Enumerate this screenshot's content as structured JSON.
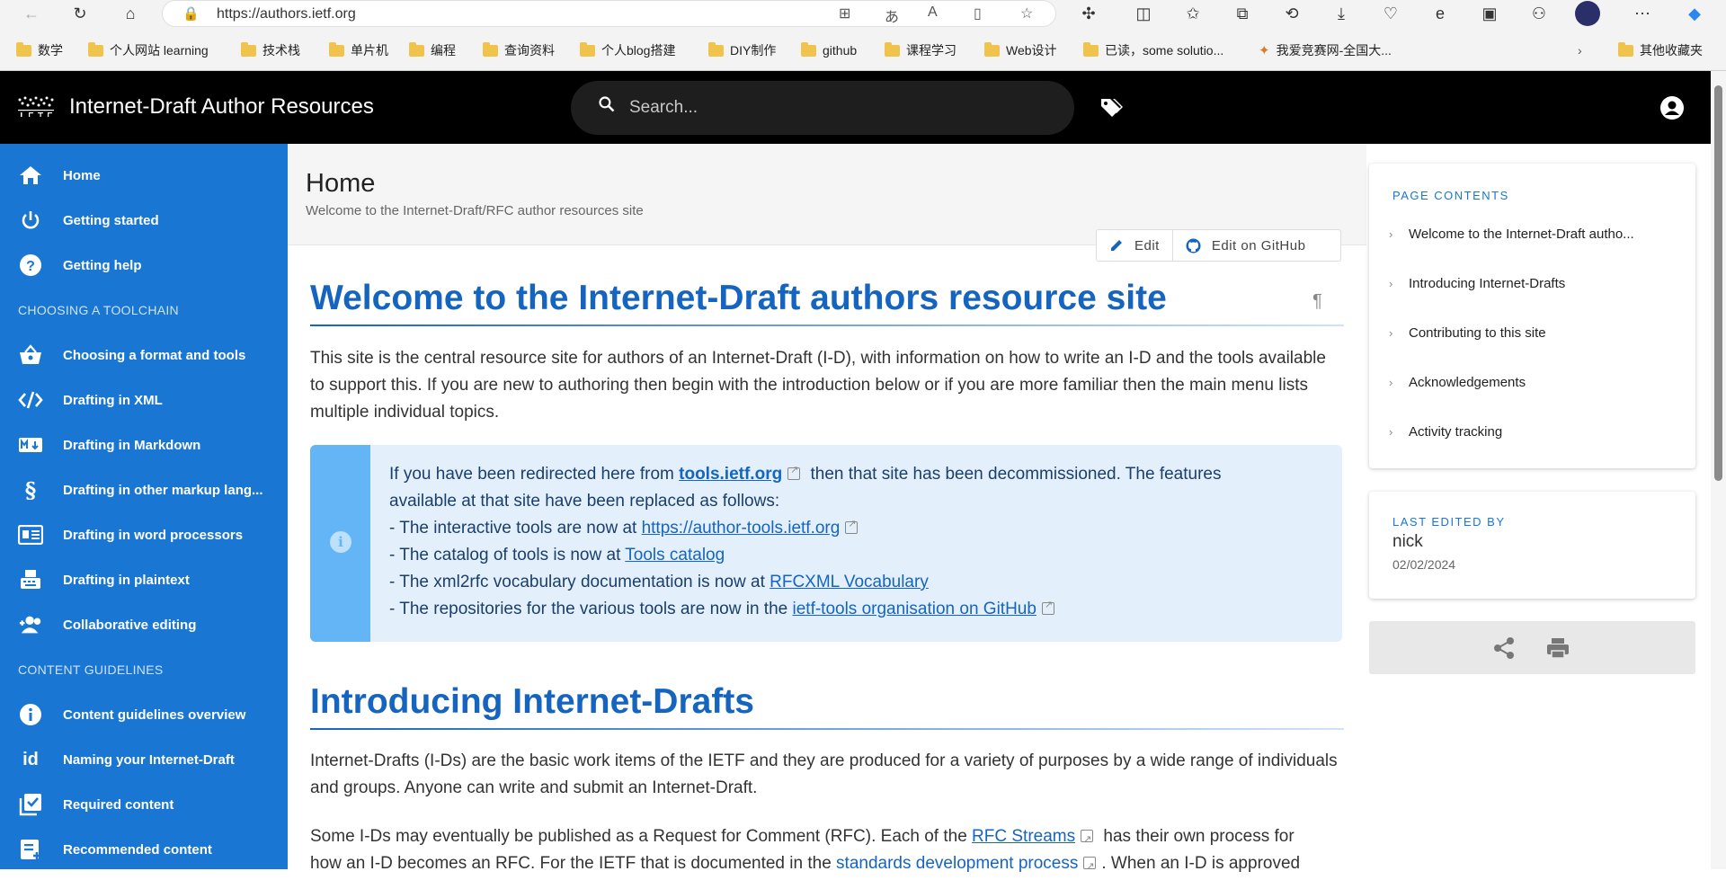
{
  "browser": {
    "url": "https://authors.ietf.org",
    "bookmarks": [
      "数学",
      "个人网站 learning",
      "技术栈",
      "单片机",
      "编程",
      "查询资料",
      "个人blog搭建",
      "DIY制作",
      "github",
      "课程学习",
      "Web设计",
      "已读，some solutio...",
      "我爱竞赛网-全国大...",
      "其他收藏夹"
    ]
  },
  "header": {
    "title": "Internet-Draft Author Resources",
    "logo_text": "I E T F",
    "search_placeholder": "Search..."
  },
  "sidebar": {
    "items": [
      {
        "label": "Home",
        "icon": "home-icon"
      },
      {
        "label": "Getting started",
        "icon": "power-icon"
      },
      {
        "label": "Getting help",
        "icon": "help-icon"
      },
      {
        "section": "CHOOSING A TOOLCHAIN"
      },
      {
        "label": "Choosing a format and tools",
        "icon": "basket-icon"
      },
      {
        "label": "Drafting in XML",
        "icon": "code-icon"
      },
      {
        "label": "Drafting in Markdown",
        "icon": "markdown-icon"
      },
      {
        "label": "Drafting in other markup lang...",
        "icon": "section-icon"
      },
      {
        "label": "Drafting in word processors",
        "icon": "document-icon"
      },
      {
        "label": "Drafting in plaintext",
        "icon": "typewriter-icon"
      },
      {
        "label": "Collaborative editing",
        "icon": "add-user-icon"
      },
      {
        "section": "CONTENT GUIDELINES"
      },
      {
        "label": "Content guidelines overview",
        "icon": "info-icon"
      },
      {
        "label": "Naming your Internet-Draft",
        "icon": "id-icon"
      },
      {
        "label": "Required content",
        "icon": "checklist-icon"
      },
      {
        "label": "Recommended content",
        "icon": "add-note-icon"
      }
    ]
  },
  "page": {
    "title": "Home",
    "subtitle": "Welcome to the Internet-Draft/RFC author resources site",
    "edit_label": "Edit",
    "edit_github_label": "Edit on GitHub",
    "h1": "Welcome to the Internet-Draft authors resource site",
    "pilcrow": "¶",
    "intro": "This site is the central resource site for authors of an Internet-Draft (I-D), with information on how to write an I-D and the tools available to support this. If you are new to authoring then begin with the introduction below or if you are more familiar then the main menu lists multiple individual topics.",
    "alert": {
      "l1_pre": "If you have been redirected here from ",
      "l1_link": "tools.ietf.org",
      "l1_post": " then that site has been decommissioned. The features",
      "l2": "available at that site have been replaced as follows:",
      "l3_pre": "- The interactive tools are now at ",
      "l3_link": "https://author-tools.ietf.org",
      "l4_pre": "- The catalog of tools is now at ",
      "l4_link": "Tools catalog",
      "l5_pre": "- The xml2rfc vocabulary documentation is now at ",
      "l5_link": "RFCXML Vocabulary",
      "l6_pre": "- The repositories for the various tools are now in the ",
      "l6_link": "ietf-tools organisation on GitHub"
    },
    "h2": "Introducing Internet-Drafts",
    "p2": "Internet-Drafts (I-Ds) are the basic work items of the IETF and they are produced for a variety of purposes by a wide range of individuals and groups. Anyone can write and submit an Internet-Draft.",
    "p3_a": "Some I-Ds may eventually be published as a Request for Comment (RFC). Each of the ",
    "p3_link1": "RFC Streams",
    "p3_b": " has their own process for",
    "p3_c": "how an I-D becomes an RFC. For the IETF that is documented in the ",
    "p3_link2": "standards development process",
    "p3_d": ". When an I-D is approved"
  },
  "toc": {
    "heading": "PAGE CONTENTS",
    "items": [
      "Welcome to the Internet-Draft autho...",
      "Introducing Internet-Drafts",
      "Contributing to this site",
      "Acknowledgements",
      "Activity tracking"
    ]
  },
  "last_edited": {
    "heading": "LAST EDITED BY",
    "name": "nick",
    "date": "02/02/2024"
  },
  "colors": {
    "nav": "#1976d2",
    "heading": "#1565c0",
    "appbar": "#000000"
  }
}
